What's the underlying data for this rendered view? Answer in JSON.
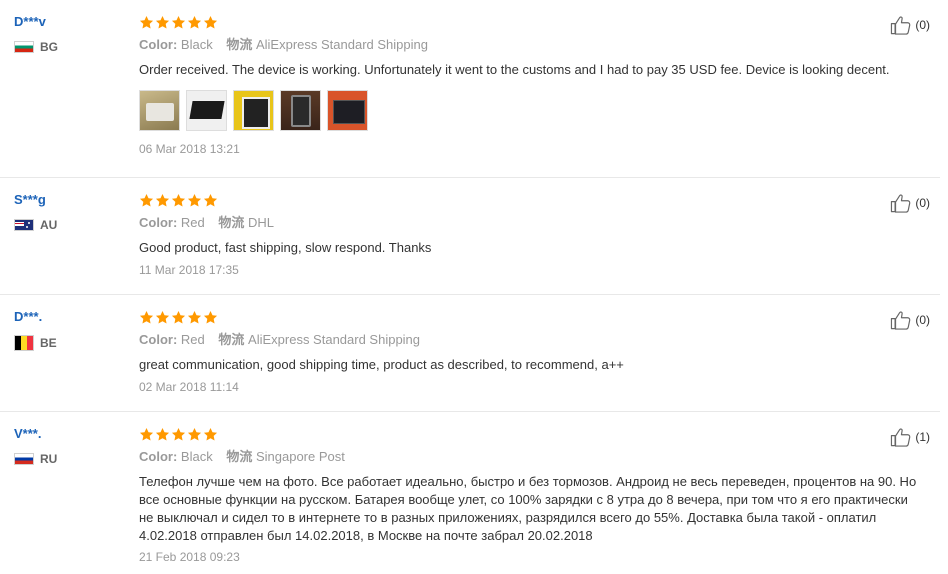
{
  "reviews": [
    {
      "username": "D***v",
      "country": "BG",
      "color_label": "Color:",
      "color": "Black",
      "shipping_label": "物流",
      "shipping": "AliExpress Standard Shipping",
      "text": "Order received. The device is working. Unfortunately it went to the customs and I had to pay 35 USD fee. Device is looking decent.",
      "date": "06 Mar 2018 13:21",
      "helpful": "(0)",
      "photos": [
        "photo-1",
        "photo-2",
        "photo-3",
        "photo-4",
        "photo-5"
      ]
    },
    {
      "username": "S***g",
      "country": "AU",
      "color_label": "Color:",
      "color": "Red",
      "shipping_label": "物流",
      "shipping": "DHL",
      "text": "Good product, fast shipping, slow respond. Thanks",
      "date": "11 Mar 2018 17:35",
      "helpful": "(0)"
    },
    {
      "username": "D***.",
      "country": "BE",
      "color_label": "Color:",
      "color": "Red",
      "shipping_label": "物流",
      "shipping": "AliExpress Standard Shipping",
      "text": "great communication, good shipping time, product as described, to recommend, a++",
      "date": "02 Mar 2018 11:14",
      "helpful": "(0)"
    },
    {
      "username": "V***.",
      "country": "RU",
      "color_label": "Color:",
      "color": "Black",
      "shipping_label": "物流",
      "shipping": "Singapore Post",
      "text": "Телефон лучше чем на фото. Все работает идеально, быстро и без тормозов. Андроид не весь переведен, процентов на 90. Но все основные функции на русском. Батарея вообще улет, со 100% зарядки с 8 утра до 8 вечера, при том что я его практически не выключал и сидел то в интернете то в разных приложениях, разрядился всего до 55%. Доставка была такой - оплатил 4.02.2018 отправлен был 14.02.2018, в Москве на почте забрал 20.02.2018",
      "date": "21 Feb 2018 09:23",
      "helpful": "(1)"
    }
  ],
  "rating_stars": 5,
  "star_color": "#ff9900",
  "username_color": "#1c63b8"
}
